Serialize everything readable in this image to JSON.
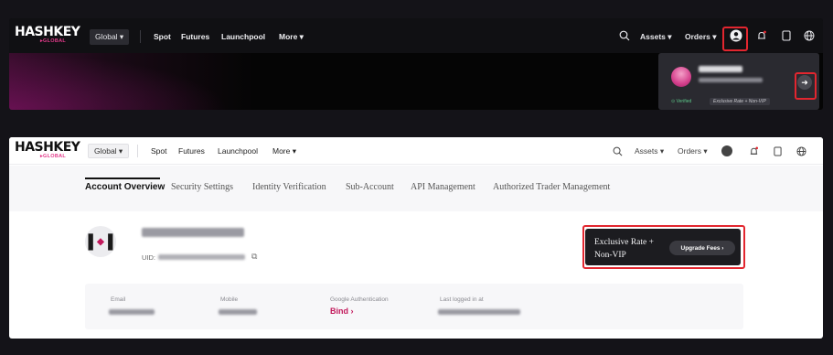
{
  "brand": {
    "name": "HASHKEY",
    "sub": "▸GLOBAL",
    "accent": "#c2185b",
    "highlight": "#e2262f"
  },
  "top": {
    "nav": {
      "global_label": "Global ▾",
      "links": [
        "Spot",
        "Futures",
        "Launchpool",
        "More ▾"
      ],
      "right": {
        "assets": "Assets ▾",
        "orders": "Orders ▾"
      },
      "icons": [
        "search-icon",
        "user-icon",
        "bell-icon",
        "tablet-icon",
        "globe-icon"
      ]
    },
    "popover": {
      "verified": "⊙ Verified",
      "rate": "Exclusive Rate + Non-VIP",
      "arrow": "➜"
    }
  },
  "bottom": {
    "nav": {
      "global_label": "Global ▾",
      "links": [
        "Spot",
        "Futures",
        "Launchpool",
        "More ▾"
      ],
      "right": {
        "assets": "Assets ▾",
        "orders": "Orders ▾"
      }
    },
    "tabs": [
      "Account Overview",
      "Security Settings",
      "Identity Verification",
      "Sub-Account",
      "API Management",
      "Authorized Trader Management"
    ],
    "account": {
      "uid_label": "UID:",
      "vip_line1": "Exclusive Rate +",
      "vip_line2": "Non-VIP",
      "upgrade_label": "Upgrade Fees  ›"
    },
    "info": {
      "email_label": "Email",
      "mobile_label": "Mobile",
      "ga_label": "Google Authentication",
      "ga_value": "Bind  ›",
      "last_login_label": "Last logged in at"
    }
  }
}
